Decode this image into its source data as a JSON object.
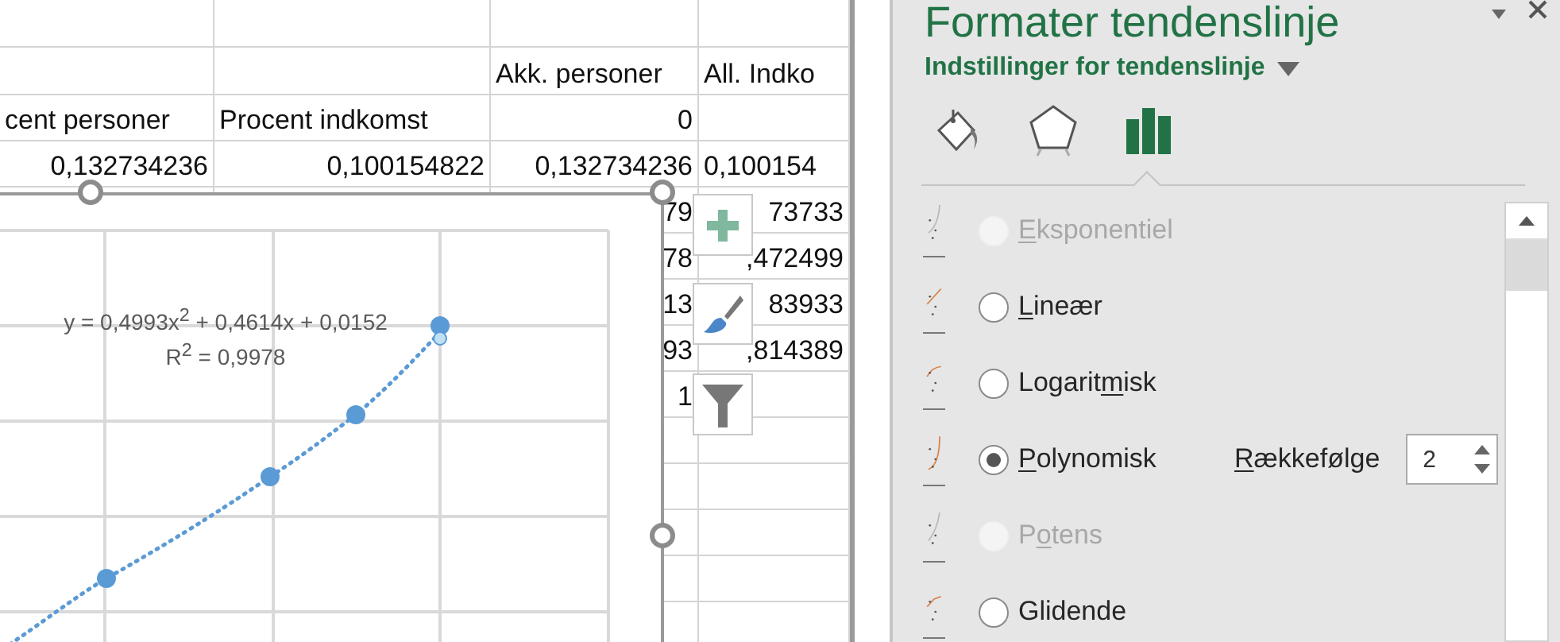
{
  "sheet": {
    "rows": [
      {},
      {
        "column_3": {
          "text": "Akk. personer",
          "kind": "text"
        },
        "column_4": {
          "text": "All. Indko",
          "kind": "text"
        }
      },
      {
        "column_1": {
          "text": "cent personer",
          "kind": "text"
        },
        "column_2": {
          "text": "Procent indkomst",
          "kind": "text"
        },
        "column_3": {
          "text": "0",
          "kind": "number"
        }
      },
      {
        "column_1": {
          "text": "0,132734236",
          "kind": "number"
        },
        "column_2": {
          "text": "0,100154822",
          "kind": "number"
        },
        "column_3": {
          "text": "0,132734236",
          "kind": "number"
        },
        "column_4": {
          "text": "0,100154",
          "kind": "text"
        }
      },
      {
        "column_3": {
          "text": "79",
          "kind": "number"
        },
        "column_4": {
          "text": "73733",
          "kind": "number"
        }
      },
      {
        "column_3": {
          "text": "78",
          "kind": "number"
        },
        "column_4": {
          "text": ",472499",
          "kind": "number"
        }
      },
      {
        "column_3": {
          "text": "13",
          "kind": "number"
        },
        "column_4": {
          "text": "83933",
          "kind": "number"
        }
      },
      {
        "column_3": {
          "text": "93",
          "kind": "number"
        },
        "column_4": {
          "text": ",814389",
          "kind": "number"
        }
      },
      {
        "column_3": {
          "text": "1",
          "kind": "number"
        }
      }
    ]
  },
  "chart": {
    "equation": "y = 0,4993x$^{2}$ + 0,4614x + 0,0152",
    "r_squared": "R$^{2}$ = 0,9978"
  },
  "panel": {
    "title": "Formater tendenslinje",
    "section": "Indstillinger for tendenslinje",
    "tabs": [
      {
        "kind": "fill",
        "selected": false
      },
      {
        "kind": "effects",
        "selected": false
      },
      {
        "kind": "options",
        "selected": true
      }
    ],
    "options": [
      {
        "kind": "exponential",
        "label": [
          {
            "text": "E",
            "underlined": true
          },
          {
            "text": "ksponentiel",
            "underlined": false
          }
        ],
        "selected": false,
        "disabled": true
      },
      {
        "kind": "linear",
        "label": [
          {
            "text": "L",
            "underlined": true
          },
          {
            "text": "ineær",
            "underlined": false
          }
        ],
        "selected": false,
        "disabled": false
      },
      {
        "kind": "logarithmic",
        "label": [
          {
            "text": "Logarit",
            "underlined": false
          },
          {
            "text": "m",
            "underlined": true
          },
          {
            "text": "isk",
            "underlined": false
          }
        ],
        "selected": false,
        "disabled": false
      },
      {
        "kind": "polynomial",
        "label": [
          {
            "text": "P",
            "underlined": true
          },
          {
            "text": "olynomisk",
            "underlined": false
          }
        ],
        "selected": true,
        "disabled": false,
        "order": {
          "label": [
            {
              "text": "R",
              "underlined": true
            },
            {
              "text": "ækkefølge",
              "underlined": false
            }
          ],
          "value": "2"
        }
      },
      {
        "kind": "power",
        "label": [
          {
            "text": "P",
            "underlined": false
          },
          {
            "text": "o",
            "underlined": true
          },
          {
            "text": "tens",
            "underlined": false
          }
        ],
        "selected": false,
        "disabled": true
      },
      {
        "kind": "moving_average",
        "label": [
          {
            "text": "Glidende",
            "underlined": false
          }
        ],
        "selected": false,
        "disabled": false
      }
    ]
  }
}
